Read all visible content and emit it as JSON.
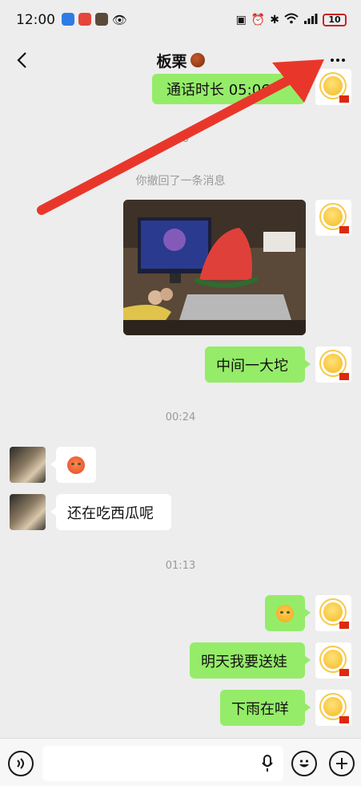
{
  "status_bar": {
    "time": "12:00",
    "battery": "10",
    "signal_label": "6"
  },
  "header": {
    "title": "板栗"
  },
  "messages": {
    "call_duration": "通话时长 05:06",
    "ts_partial": ":20",
    "recalled": "你撤回了一条消息",
    "msg_middle": "中间一大坨",
    "ts_0024": "00:24",
    "msg_watermelon": "还在吃西瓜呢",
    "ts_0113": "01:13",
    "msg_tomorrow": "明天我要送娃",
    "msg_rain": "下雨在咩"
  },
  "colors": {
    "bubble_me": "#95ec69",
    "bubble_other": "#ffffff",
    "arrow": "#e8372a",
    "background": "#ededed"
  },
  "icons": {
    "back": "chevron-left-icon",
    "more": "more-dots-icon",
    "voice": "voice-icon",
    "mic": "mic-icon",
    "emoji": "emoji-icon",
    "plus": "plus-icon"
  }
}
